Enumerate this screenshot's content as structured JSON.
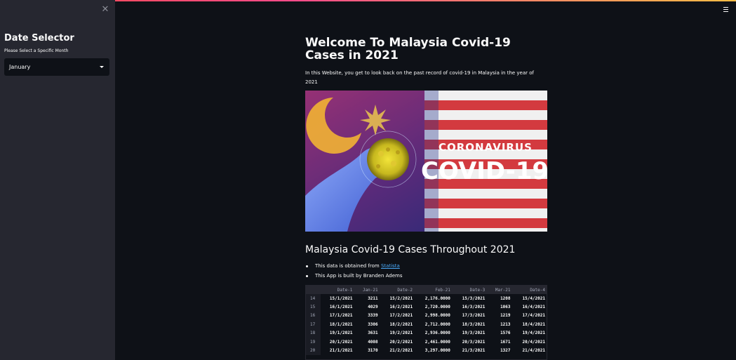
{
  "sidebar": {
    "title": "Date Selector",
    "label": "Please Select a Specific Month",
    "select_value": "January"
  },
  "main": {
    "title": "Welcome To Malaysia Covid-19 Cases in 2021",
    "intro": "In this Website, you get to look back on the past record of covid-19 in Malaysia in the year of 2021",
    "hero": {
      "line1": "CORONAVIRUS",
      "line2": "COVID-19"
    },
    "subheading": "Malaysia Covid-19 Cases Throughout 2021",
    "bullet1_prefix": "This data is obtained from ",
    "bullet1_link": "Statista",
    "bullet2": "This App is built by Branden Adems"
  },
  "table": {
    "columns": [
      "",
      "Date-1",
      "Jan-21",
      "Date-2",
      "Feb-21",
      "Date-3",
      "Mar-21",
      "Date-4"
    ],
    "rows": [
      [
        "14",
        "15/1/2021",
        "3211",
        "15/2/2021",
        "2,176.0000",
        "15/3/2021",
        "1208",
        "15/4/2021"
      ],
      [
        "15",
        "16/1/2021",
        "4029",
        "16/2/2021",
        "2,720.0000",
        "16/3/2021",
        "1063",
        "16/4/2021"
      ],
      [
        "16",
        "17/1/2021",
        "3339",
        "17/2/2021",
        "2,998.0000",
        "17/3/2021",
        "1219",
        "17/4/2021"
      ],
      [
        "17",
        "18/1/2021",
        "3306",
        "18/2/2021",
        "2,712.0000",
        "18/3/2021",
        "1213",
        "18/4/2021"
      ],
      [
        "18",
        "19/1/2021",
        "3631",
        "19/2/2021",
        "2,936.0000",
        "19/3/2021",
        "1576",
        "19/4/2021"
      ],
      [
        "19",
        "20/1/2021",
        "4008",
        "20/2/2021",
        "2,461.0000",
        "20/3/2021",
        "1671",
        "20/4/2021"
      ],
      [
        "20",
        "21/1/2021",
        "3170",
        "21/2/2021",
        "3,297.0000",
        "21/3/2021",
        "1327",
        "21/4/2021"
      ]
    ]
  }
}
